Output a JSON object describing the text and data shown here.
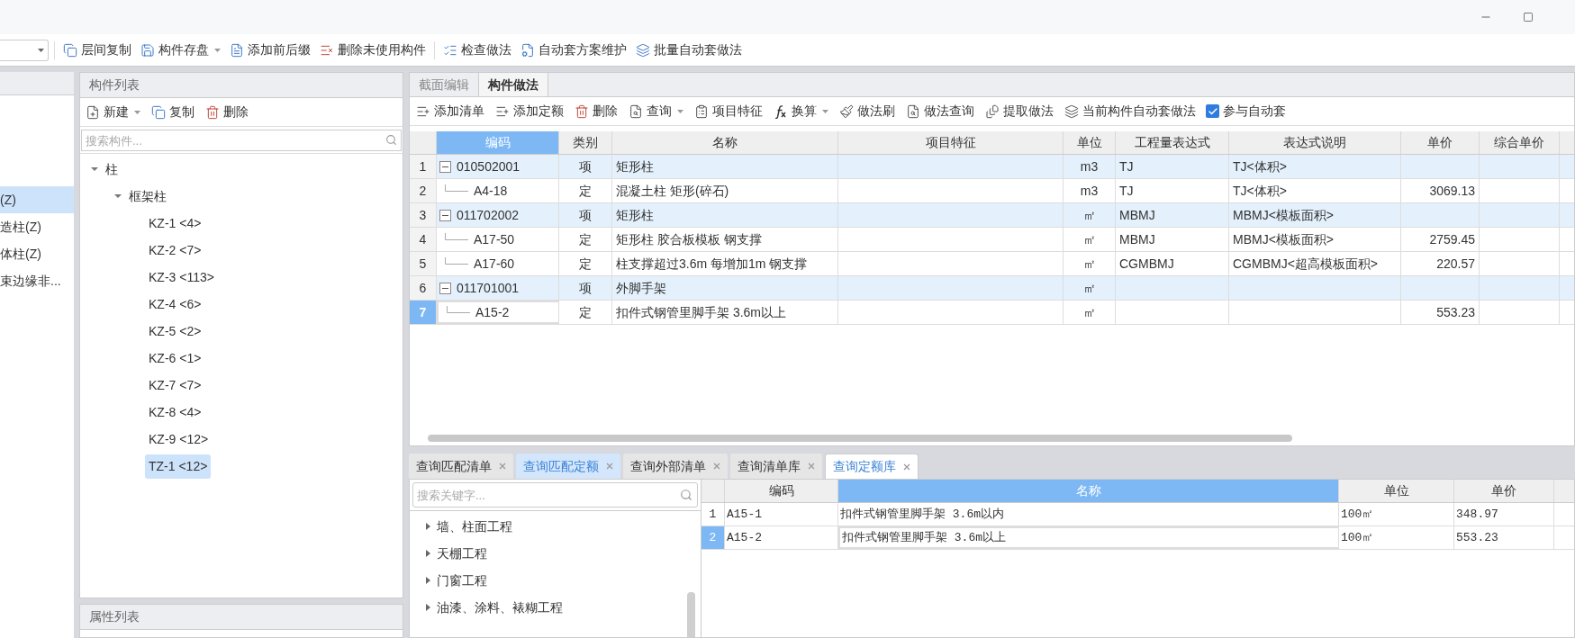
{
  "toolbar": [
    {
      "label": "层间复制",
      "menu": false
    },
    {
      "label": "构件存盘",
      "menu": true
    },
    {
      "label": "添加前后缀",
      "menu": false
    },
    {
      "label": "删除未使用构件",
      "menu": false
    },
    {
      "label": "检查做法",
      "menu": false
    },
    {
      "label": "自动套方案维护",
      "menu": false
    },
    {
      "label": "批量自动套做法",
      "menu": false
    }
  ],
  "category_list": {
    "items": [
      {
        "label": "(Z)",
        "selected": true
      },
      {
        "label": "造柱(Z)",
        "selected": false
      },
      {
        "label": "体柱(Z)",
        "selected": false
      },
      {
        "label": "束边缘非...",
        "selected": false
      }
    ]
  },
  "component_list": {
    "title": "构件列表",
    "buttons": [
      {
        "label": "新建",
        "menu": true
      },
      {
        "label": "复制",
        "menu": false
      },
      {
        "label": "删除",
        "menu": false
      }
    ],
    "search": {
      "placeholder": "搜索构件..."
    },
    "tree": [
      {
        "label": "柱",
        "expanded": true,
        "selected": false,
        "children": [
          {
            "label": "框架柱",
            "expanded": true,
            "selected": false,
            "children": [
              {
                "label": "KZ-1 <4>",
                "selected": false
              },
              {
                "label": "KZ-2 <7>",
                "selected": false
              },
              {
                "label": "KZ-3 <113>",
                "selected": false
              },
              {
                "label": "KZ-4 <6>",
                "selected": false
              },
              {
                "label": "KZ-5 <2>",
                "selected": false
              },
              {
                "label": "KZ-6 <1>",
                "selected": false
              },
              {
                "label": "KZ-7 <7>",
                "selected": false
              },
              {
                "label": "KZ-8 <4>",
                "selected": false
              },
              {
                "label": "KZ-9 <12>",
                "selected": false
              },
              {
                "label": "TZ-1 <12>",
                "selected": true
              }
            ]
          }
        ]
      }
    ]
  },
  "property_list": {
    "title": "属性列表"
  },
  "main_tabs": [
    {
      "label": "截面编辑",
      "selected": false
    },
    {
      "label": "构件做法",
      "selected": true
    }
  ],
  "main_toolbar": {
    "buttons": [
      {
        "label": "添加清单",
        "menu": false
      },
      {
        "label": "添加定额",
        "menu": false
      },
      {
        "label": "删除",
        "menu": false
      },
      {
        "label": "查询",
        "menu": true
      },
      {
        "label": "项目特征",
        "menu": false
      },
      {
        "label": "换算",
        "menu": true
      },
      {
        "label": "做法刷",
        "menu": false
      },
      {
        "label": "做法查询",
        "menu": false
      },
      {
        "label": "提取做法",
        "menu": false
      },
      {
        "label": "当前构件自动套做法",
        "menu": false
      }
    ],
    "checkbox": {
      "label": "参与自动套",
      "checked": true
    }
  },
  "methods_table": {
    "columns": [
      {
        "label": "编码",
        "selected": true
      },
      {
        "label": "类别",
        "selected": false
      },
      {
        "label": "名称",
        "selected": false
      },
      {
        "label": "项目特征",
        "selected": false
      },
      {
        "label": "单位",
        "selected": false
      },
      {
        "label": "工程量表达式",
        "selected": false
      },
      {
        "label": "表达式说明",
        "selected": false
      },
      {
        "label": "单价",
        "selected": false
      },
      {
        "label": "综合单价",
        "selected": false
      }
    ],
    "rows": [
      {
        "num": "1",
        "kind": "item",
        "expanded": true,
        "selected": false,
        "code": "010502001",
        "type": "项",
        "name": "矩形柱",
        "unit": "m3",
        "expr": "TJ",
        "desc": "TJ<体积>"
      },
      {
        "num": "2",
        "kind": "sub",
        "selected": false,
        "code": "A4-18",
        "type": "定",
        "name": "混凝土柱 矩形(碎石)",
        "unit": "m3",
        "expr": "TJ",
        "desc": "TJ<体积>",
        "price": "3069.13"
      },
      {
        "num": "3",
        "kind": "item",
        "expanded": true,
        "selected": false,
        "code": "011702002",
        "type": "项",
        "name": "矩形柱",
        "unit": "㎡",
        "expr": "MBMJ",
        "desc": "MBMJ<模板面积>"
      },
      {
        "num": "4",
        "kind": "sub",
        "selected": false,
        "code": "A17-50",
        "type": "定",
        "name": "矩形柱 胶合板模板 钢支撑",
        "unit": "㎡",
        "expr": "MBMJ",
        "desc": "MBMJ<模板面积>",
        "price": "2759.45"
      },
      {
        "num": "5",
        "kind": "sub",
        "selected": false,
        "code": "A17-60",
        "type": "定",
        "name": "柱支撑超过3.6m 每增加1m 钢支撑",
        "unit": "㎡",
        "expr": "CGMBMJ",
        "desc": "CGMBMJ<超高模板面积>",
        "price": "220.57"
      },
      {
        "num": "6",
        "kind": "item",
        "expanded": true,
        "selected": false,
        "code": "011701001",
        "type": "项",
        "name": "外脚手架",
        "unit": "㎡"
      },
      {
        "num": "7",
        "kind": "sub",
        "selected": true,
        "code": "A15-2",
        "type": "定",
        "name": "扣件式钢管里脚手架 3.6m以上",
        "unit": "㎡",
        "price": "553.23"
      }
    ]
  },
  "query_tabs": [
    {
      "label": "查询匹配清单",
      "selected": false,
      "highlighted": false
    },
    {
      "label": "查询匹配定额",
      "selected": false,
      "highlighted": true
    },
    {
      "label": "查询外部清单",
      "selected": false,
      "highlighted": false
    },
    {
      "label": "查询清单库",
      "selected": false,
      "highlighted": false
    },
    {
      "label": "查询定额库",
      "selected": true,
      "highlighted": false
    }
  ],
  "quota_tree": {
    "search": {
      "placeholder": "搜索关键字..."
    },
    "items": [
      {
        "label": "墙、柱面工程",
        "expanded": false
      },
      {
        "label": "天棚工程",
        "expanded": false
      },
      {
        "label": "门窗工程",
        "expanded": false
      },
      {
        "label": "油漆、涂料、裱糊工程",
        "expanded": false
      }
    ]
  },
  "quota_table": {
    "columns": [
      {
        "label": "编码",
        "selected": false
      },
      {
        "label": "名称",
        "selected": true
      },
      {
        "label": "单位",
        "selected": false
      },
      {
        "label": "单价",
        "selected": false
      }
    ],
    "rows": [
      {
        "num": "1",
        "selected": false,
        "code": "A15-1",
        "name": "扣件式钢管里脚手架 3.6m以内",
        "unit": "100㎡",
        "price": "348.97"
      },
      {
        "num": "2",
        "selected": true,
        "code": "A15-2",
        "name": "扣件式钢管里脚手架 3.6m以上",
        "unit": "100㎡",
        "price": "553.23"
      }
    ]
  }
}
